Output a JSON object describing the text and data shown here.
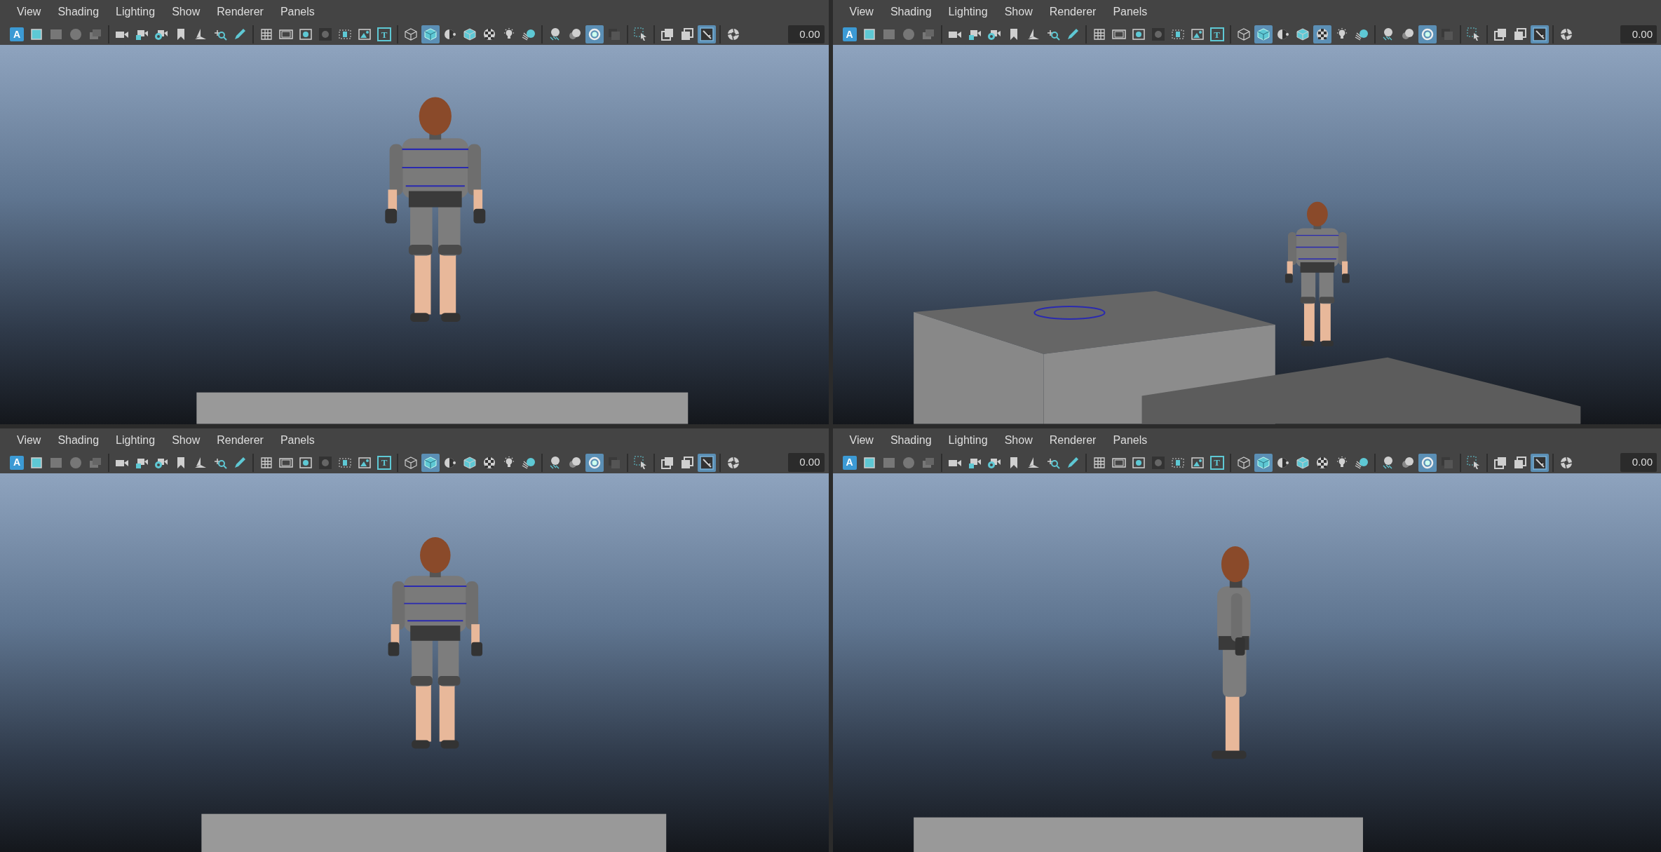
{
  "panels": [
    {
      "menu": [
        "View",
        "Shading",
        "Lighting",
        "Show",
        "Renderer",
        "Panels"
      ],
      "view": {
        "kind": "back"
      },
      "exposure": "0.00",
      "toolbar_groups": [
        [
          {
            "kind": "letter",
            "label": "A",
            "selected": false
          },
          {
            "kind": "frame",
            "selected": false
          },
          {
            "kind": "grid-dim",
            "selected": false
          },
          {
            "kind": "sphere-dim",
            "selected": false
          },
          {
            "kind": "layers-dim",
            "selected": false
          }
        ],
        [
          {
            "kind": "camera",
            "selected": false
          },
          {
            "kind": "camera-lock",
            "selected": false
          },
          {
            "kind": "camera-gear",
            "selected": false
          },
          {
            "kind": "bookmark",
            "selected": false
          },
          {
            "kind": "planes",
            "selected": false
          },
          {
            "kind": "move",
            "selected": false
          },
          {
            "kind": "pencil",
            "selected": false
          }
        ],
        [
          {
            "kind": "grid",
            "selected": false
          },
          {
            "kind": "film",
            "selected": false
          },
          {
            "kind": "safe",
            "selected": false
          },
          {
            "kind": "dark-circle",
            "selected": false
          },
          {
            "kind": "dots",
            "selected": false
          },
          {
            "kind": "image",
            "selected": false
          },
          {
            "kind": "letter-frame",
            "label": "T",
            "selected": false
          }
        ],
        [
          {
            "kind": "wire-cube",
            "selected": false
          },
          {
            "kind": "solid-cube",
            "selected": true
          },
          {
            "kind": "half",
            "selected": false
          },
          {
            "kind": "tex-cube",
            "selected": false
          },
          {
            "kind": "checker",
            "selected": false
          },
          {
            "kind": "bulb",
            "selected": false
          },
          {
            "kind": "shadow",
            "selected": false
          }
        ],
        [
          {
            "kind": "smooth",
            "selected": false
          },
          {
            "kind": "spheres",
            "selected": false
          },
          {
            "kind": "ring",
            "selected": true
          },
          {
            "kind": "dark-square",
            "selected": false
          }
        ],
        [
          {
            "kind": "select",
            "selected": false
          }
        ],
        [
          {
            "kind": "isolate",
            "selected": false
          },
          {
            "kind": "isolate2",
            "selected": false
          },
          {
            "kind": "pen-frame",
            "selected": true
          }
        ],
        [
          {
            "kind": "aperture",
            "selected": false
          }
        ]
      ]
    },
    {
      "menu": [
        "View",
        "Shading",
        "Lighting",
        "Show",
        "Renderer",
        "Panels"
      ],
      "view": {
        "kind": "perspective"
      },
      "exposure": "0.00",
      "toolbar_groups": [
        [
          {
            "kind": "letter",
            "label": "A",
            "selected": false
          },
          {
            "kind": "frame",
            "selected": false
          },
          {
            "kind": "grid-dim",
            "selected": false
          },
          {
            "kind": "sphere-dim",
            "selected": false
          },
          {
            "kind": "layers-dim",
            "selected": false
          }
        ],
        [
          {
            "kind": "camera",
            "selected": false
          },
          {
            "kind": "camera-lock",
            "selected": false
          },
          {
            "kind": "camera-gear",
            "selected": false
          },
          {
            "kind": "bookmark",
            "selected": false
          },
          {
            "kind": "planes",
            "selected": false
          },
          {
            "kind": "move",
            "selected": false
          },
          {
            "kind": "pencil",
            "selected": false
          }
        ],
        [
          {
            "kind": "grid",
            "selected": false
          },
          {
            "kind": "film",
            "selected": false
          },
          {
            "kind": "safe",
            "selected": false
          },
          {
            "kind": "dark-circle",
            "selected": false
          },
          {
            "kind": "dots",
            "selected": false
          },
          {
            "kind": "image",
            "selected": false
          },
          {
            "kind": "letter-frame",
            "label": "T",
            "selected": false
          }
        ],
        [
          {
            "kind": "wire-cube",
            "selected": false
          },
          {
            "kind": "solid-cube",
            "selected": true
          },
          {
            "kind": "half",
            "selected": false
          },
          {
            "kind": "tex-cube",
            "selected": false
          },
          {
            "kind": "checker",
            "selected": true
          },
          {
            "kind": "bulb",
            "selected": false
          },
          {
            "kind": "shadow",
            "selected": false
          }
        ],
        [
          {
            "kind": "smooth",
            "selected": false
          },
          {
            "kind": "spheres",
            "selected": false
          },
          {
            "kind": "ring",
            "selected": true
          },
          {
            "kind": "dark-square",
            "selected": false
          }
        ],
        [
          {
            "kind": "select",
            "selected": false
          }
        ],
        [
          {
            "kind": "isolate",
            "selected": false
          },
          {
            "kind": "isolate2",
            "selected": false
          },
          {
            "kind": "pen-frame",
            "selected": true
          }
        ],
        [
          {
            "kind": "aperture",
            "selected": false
          }
        ]
      ]
    },
    {
      "menu": [
        "View",
        "Shading",
        "Lighting",
        "Show",
        "Renderer",
        "Panels"
      ],
      "view": {
        "kind": "front"
      },
      "exposure": "0.00",
      "toolbar_groups": [
        [
          {
            "kind": "letter",
            "label": "A",
            "selected": false
          },
          {
            "kind": "frame",
            "selected": false
          },
          {
            "kind": "grid-dim",
            "selected": false
          },
          {
            "kind": "sphere-dim",
            "selected": false
          },
          {
            "kind": "layers-dim",
            "selected": false
          }
        ],
        [
          {
            "kind": "camera",
            "selected": false
          },
          {
            "kind": "camera-lock",
            "selected": false
          },
          {
            "kind": "camera-gear",
            "selected": false
          },
          {
            "kind": "bookmark",
            "selected": false
          },
          {
            "kind": "planes",
            "selected": false
          },
          {
            "kind": "move",
            "selected": false
          },
          {
            "kind": "pencil",
            "selected": false
          }
        ],
        [
          {
            "kind": "grid",
            "selected": false
          },
          {
            "kind": "film",
            "selected": false
          },
          {
            "kind": "safe",
            "selected": false
          },
          {
            "kind": "dark-circle",
            "selected": false
          },
          {
            "kind": "dots",
            "selected": false
          },
          {
            "kind": "image",
            "selected": false
          },
          {
            "kind": "letter-frame",
            "label": "T",
            "selected": false
          }
        ],
        [
          {
            "kind": "wire-cube",
            "selected": false
          },
          {
            "kind": "solid-cube",
            "selected": true
          },
          {
            "kind": "half",
            "selected": false
          },
          {
            "kind": "tex-cube",
            "selected": false
          },
          {
            "kind": "checker",
            "selected": false
          },
          {
            "kind": "bulb",
            "selected": false
          },
          {
            "kind": "shadow",
            "selected": false
          }
        ],
        [
          {
            "kind": "smooth",
            "selected": false
          },
          {
            "kind": "spheres",
            "selected": false
          },
          {
            "kind": "ring",
            "selected": true
          },
          {
            "kind": "dark-square",
            "selected": false
          }
        ],
        [
          {
            "kind": "select",
            "selected": false
          }
        ],
        [
          {
            "kind": "isolate",
            "selected": false
          },
          {
            "kind": "isolate2",
            "selected": false
          },
          {
            "kind": "pen-frame",
            "selected": true
          }
        ],
        [
          {
            "kind": "aperture",
            "selected": false
          }
        ]
      ]
    },
    {
      "menu": [
        "View",
        "Shading",
        "Lighting",
        "Show",
        "Renderer",
        "Panels"
      ],
      "view": {
        "kind": "side"
      },
      "exposure": "0.00",
      "toolbar_groups": [
        [
          {
            "kind": "letter",
            "label": "A",
            "selected": false
          },
          {
            "kind": "frame",
            "selected": false
          },
          {
            "kind": "grid-dim",
            "selected": false
          },
          {
            "kind": "sphere-dim",
            "selected": false
          },
          {
            "kind": "layers-dim",
            "selected": false
          }
        ],
        [
          {
            "kind": "camera",
            "selected": false
          },
          {
            "kind": "camera-lock",
            "selected": false
          },
          {
            "kind": "camera-gear",
            "selected": false
          },
          {
            "kind": "bookmark",
            "selected": false
          },
          {
            "kind": "planes",
            "selected": false
          },
          {
            "kind": "move",
            "selected": false
          },
          {
            "kind": "pencil",
            "selected": false
          }
        ],
        [
          {
            "kind": "grid",
            "selected": false
          },
          {
            "kind": "film",
            "selected": false
          },
          {
            "kind": "safe",
            "selected": false
          },
          {
            "kind": "dark-circle",
            "selected": false
          },
          {
            "kind": "dots",
            "selected": false
          },
          {
            "kind": "image",
            "selected": false
          },
          {
            "kind": "letter-frame",
            "label": "T",
            "selected": false
          }
        ],
        [
          {
            "kind": "wire-cube",
            "selected": false
          },
          {
            "kind": "solid-cube",
            "selected": true
          },
          {
            "kind": "half",
            "selected": false
          },
          {
            "kind": "tex-cube",
            "selected": false
          },
          {
            "kind": "checker",
            "selected": false
          },
          {
            "kind": "bulb",
            "selected": false
          },
          {
            "kind": "shadow",
            "selected": false
          }
        ],
        [
          {
            "kind": "smooth",
            "selected": false
          },
          {
            "kind": "spheres",
            "selected": false
          },
          {
            "kind": "ring",
            "selected": true
          },
          {
            "kind": "dark-square",
            "selected": false
          }
        ],
        [
          {
            "kind": "select",
            "selected": false
          }
        ],
        [
          {
            "kind": "isolate",
            "selected": false
          },
          {
            "kind": "isolate2",
            "selected": false
          },
          {
            "kind": "pen-frame",
            "selected": true
          }
        ],
        [
          {
            "kind": "aperture",
            "selected": false
          }
        ]
      ]
    }
  ]
}
